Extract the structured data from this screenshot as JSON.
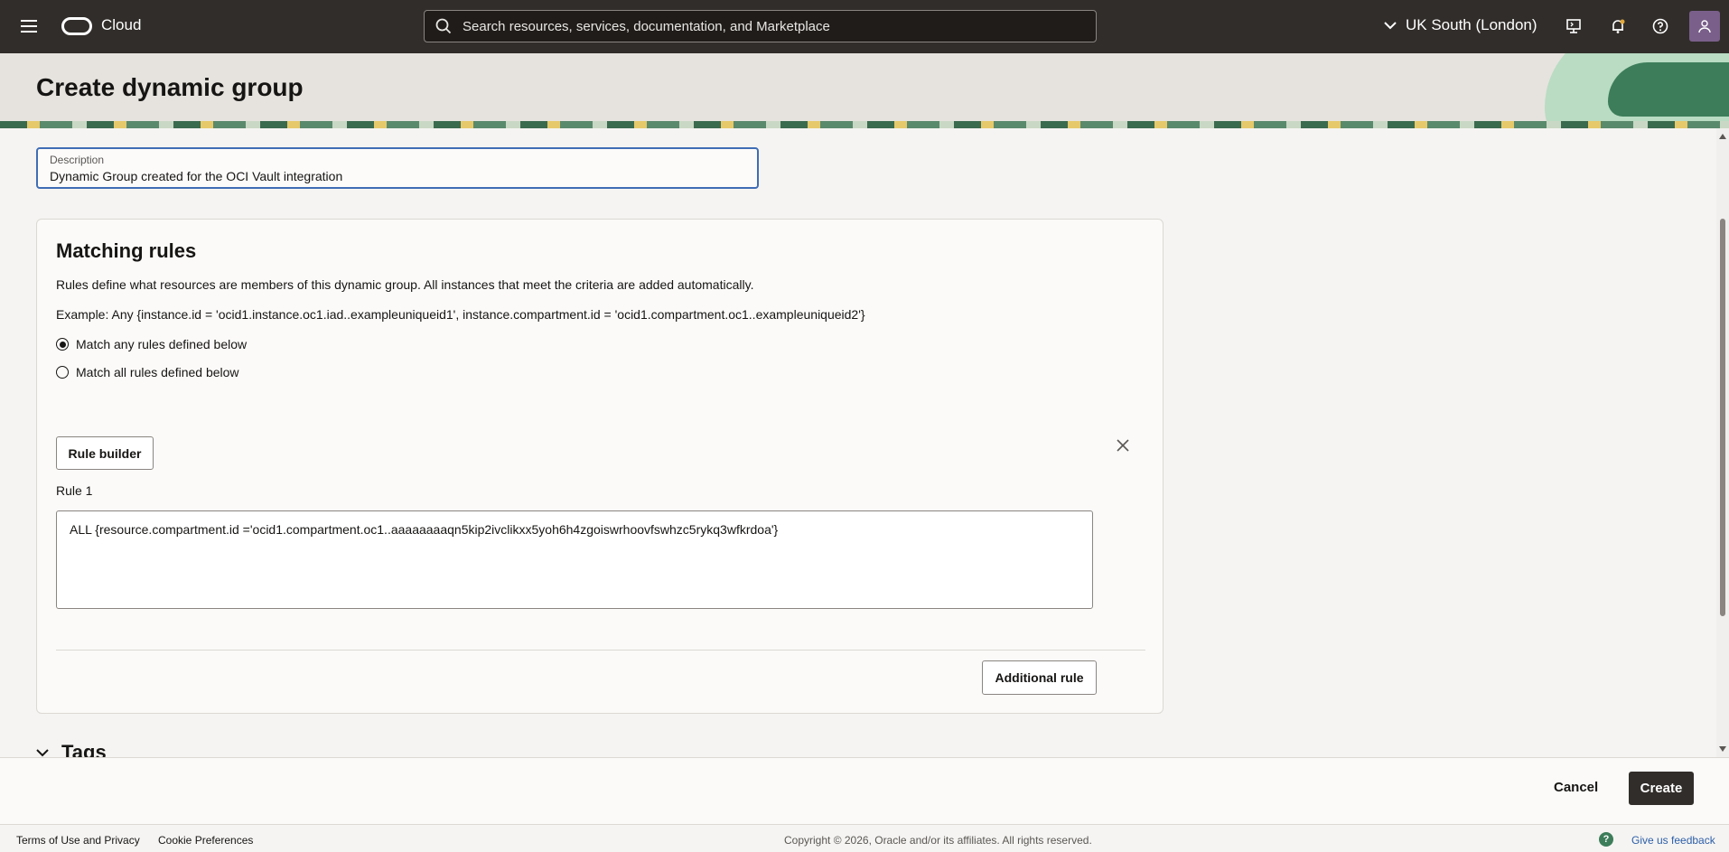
{
  "topbar": {
    "brand": "Cloud",
    "search_placeholder": "Search resources, services, documentation, and Marketplace",
    "region": "UK South (London)"
  },
  "page": {
    "title": "Create dynamic group"
  },
  "description": {
    "label": "Description",
    "value": "Dynamic Group created for the OCI Vault integration"
  },
  "matching_rules": {
    "title": "Matching rules",
    "intro": "Rules define what resources are members of this dynamic group. All instances that meet the criteria are added automatically.",
    "example": "Example: Any {instance.id = 'ocid1.instance.oc1.iad..exampleuniqueid1', instance.compartment.id = 'ocid1.compartment.oc1..exampleuniqueid2'}",
    "options": [
      {
        "label": "Match any rules defined below",
        "selected": true
      },
      {
        "label": "Match all rules defined below",
        "selected": false
      }
    ],
    "rule_builder_label": "Rule builder",
    "rule_label": "Rule 1",
    "rule_value": "ALL {resource.compartment.id ='ocid1.compartment.oc1..aaaaaaaaqn5kip2ivclikxx5yoh6h4zgoiswrhoovfswhzc5rykq3wfkrdoa'}",
    "additional_rule_label": "Additional rule"
  },
  "tags": {
    "title": "Tags"
  },
  "actions": {
    "cancel": "Cancel",
    "create": "Create"
  },
  "footer": {
    "terms": "Terms of Use and Privacy",
    "cookies": "Cookie Preferences",
    "copyright": "Copyright © 2026, Oracle and/or its affiliates. All rights reserved.",
    "feedback": "Give us feedback"
  },
  "colors": {
    "topbar": "#312d2a",
    "accent_blue": "#3f6db5",
    "primary_button": "#312d2a"
  }
}
